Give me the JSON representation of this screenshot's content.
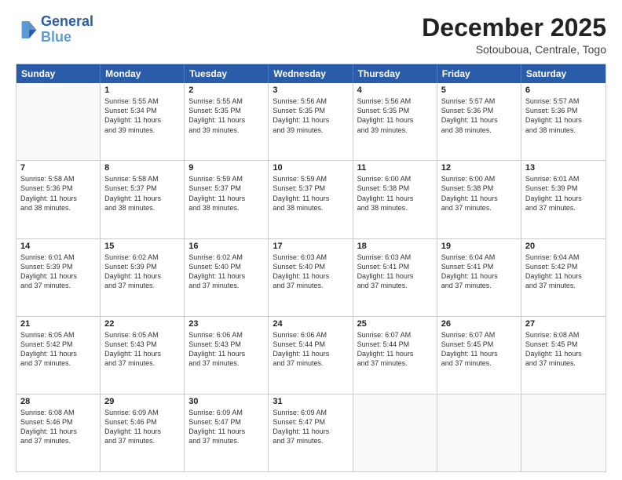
{
  "logo": {
    "line1": "General",
    "line2": "Blue"
  },
  "title": "December 2025",
  "subtitle": "Sotouboua, Centrale, Togo",
  "header_days": [
    "Sunday",
    "Monday",
    "Tuesday",
    "Wednesday",
    "Thursday",
    "Friday",
    "Saturday"
  ],
  "weeks": [
    [
      {
        "day": "",
        "sunrise": "",
        "sunset": "",
        "daylight": ""
      },
      {
        "day": "1",
        "sunrise": "Sunrise: 5:55 AM",
        "sunset": "Sunset: 5:34 PM",
        "daylight": "Daylight: 11 hours and 39 minutes."
      },
      {
        "day": "2",
        "sunrise": "Sunrise: 5:55 AM",
        "sunset": "Sunset: 5:35 PM",
        "daylight": "Daylight: 11 hours and 39 minutes."
      },
      {
        "day": "3",
        "sunrise": "Sunrise: 5:56 AM",
        "sunset": "Sunset: 5:35 PM",
        "daylight": "Daylight: 11 hours and 39 minutes."
      },
      {
        "day": "4",
        "sunrise": "Sunrise: 5:56 AM",
        "sunset": "Sunset: 5:35 PM",
        "daylight": "Daylight: 11 hours and 39 minutes."
      },
      {
        "day": "5",
        "sunrise": "Sunrise: 5:57 AM",
        "sunset": "Sunset: 5:36 PM",
        "daylight": "Daylight: 11 hours and 38 minutes."
      },
      {
        "day": "6",
        "sunrise": "Sunrise: 5:57 AM",
        "sunset": "Sunset: 5:36 PM",
        "daylight": "Daylight: 11 hours and 38 minutes."
      }
    ],
    [
      {
        "day": "7",
        "sunrise": "Sunrise: 5:58 AM",
        "sunset": "Sunset: 5:36 PM",
        "daylight": "Daylight: 11 hours and 38 minutes."
      },
      {
        "day": "8",
        "sunrise": "Sunrise: 5:58 AM",
        "sunset": "Sunset: 5:37 PM",
        "daylight": "Daylight: 11 hours and 38 minutes."
      },
      {
        "day": "9",
        "sunrise": "Sunrise: 5:59 AM",
        "sunset": "Sunset: 5:37 PM",
        "daylight": "Daylight: 11 hours and 38 minutes."
      },
      {
        "day": "10",
        "sunrise": "Sunrise: 5:59 AM",
        "sunset": "Sunset: 5:37 PM",
        "daylight": "Daylight: 11 hours and 38 minutes."
      },
      {
        "day": "11",
        "sunrise": "Sunrise: 6:00 AM",
        "sunset": "Sunset: 5:38 PM",
        "daylight": "Daylight: 11 hours and 38 minutes."
      },
      {
        "day": "12",
        "sunrise": "Sunrise: 6:00 AM",
        "sunset": "Sunset: 5:38 PM",
        "daylight": "Daylight: 11 hours and 37 minutes."
      },
      {
        "day": "13",
        "sunrise": "Sunrise: 6:01 AM",
        "sunset": "Sunset: 5:39 PM",
        "daylight": "Daylight: 11 hours and 37 minutes."
      }
    ],
    [
      {
        "day": "14",
        "sunrise": "Sunrise: 6:01 AM",
        "sunset": "Sunset: 5:39 PM",
        "daylight": "Daylight: 11 hours and 37 minutes."
      },
      {
        "day": "15",
        "sunrise": "Sunrise: 6:02 AM",
        "sunset": "Sunset: 5:39 PM",
        "daylight": "Daylight: 11 hours and 37 minutes."
      },
      {
        "day": "16",
        "sunrise": "Sunrise: 6:02 AM",
        "sunset": "Sunset: 5:40 PM",
        "daylight": "Daylight: 11 hours and 37 minutes."
      },
      {
        "day": "17",
        "sunrise": "Sunrise: 6:03 AM",
        "sunset": "Sunset: 5:40 PM",
        "daylight": "Daylight: 11 hours and 37 minutes."
      },
      {
        "day": "18",
        "sunrise": "Sunrise: 6:03 AM",
        "sunset": "Sunset: 5:41 PM",
        "daylight": "Daylight: 11 hours and 37 minutes."
      },
      {
        "day": "19",
        "sunrise": "Sunrise: 6:04 AM",
        "sunset": "Sunset: 5:41 PM",
        "daylight": "Daylight: 11 hours and 37 minutes."
      },
      {
        "day": "20",
        "sunrise": "Sunrise: 6:04 AM",
        "sunset": "Sunset: 5:42 PM",
        "daylight": "Daylight: 11 hours and 37 minutes."
      }
    ],
    [
      {
        "day": "21",
        "sunrise": "Sunrise: 6:05 AM",
        "sunset": "Sunset: 5:42 PM",
        "daylight": "Daylight: 11 hours and 37 minutes."
      },
      {
        "day": "22",
        "sunrise": "Sunrise: 6:05 AM",
        "sunset": "Sunset: 5:43 PM",
        "daylight": "Daylight: 11 hours and 37 minutes."
      },
      {
        "day": "23",
        "sunrise": "Sunrise: 6:06 AM",
        "sunset": "Sunset: 5:43 PM",
        "daylight": "Daylight: 11 hours and 37 minutes."
      },
      {
        "day": "24",
        "sunrise": "Sunrise: 6:06 AM",
        "sunset": "Sunset: 5:44 PM",
        "daylight": "Daylight: 11 hours and 37 minutes."
      },
      {
        "day": "25",
        "sunrise": "Sunrise: 6:07 AM",
        "sunset": "Sunset: 5:44 PM",
        "daylight": "Daylight: 11 hours and 37 minutes."
      },
      {
        "day": "26",
        "sunrise": "Sunrise: 6:07 AM",
        "sunset": "Sunset: 5:45 PM",
        "daylight": "Daylight: 11 hours and 37 minutes."
      },
      {
        "day": "27",
        "sunrise": "Sunrise: 6:08 AM",
        "sunset": "Sunset: 5:45 PM",
        "daylight": "Daylight: 11 hours and 37 minutes."
      }
    ],
    [
      {
        "day": "28",
        "sunrise": "Sunrise: 6:08 AM",
        "sunset": "Sunset: 5:46 PM",
        "daylight": "Daylight: 11 hours and 37 minutes."
      },
      {
        "day": "29",
        "sunrise": "Sunrise: 6:09 AM",
        "sunset": "Sunset: 5:46 PM",
        "daylight": "Daylight: 11 hours and 37 minutes."
      },
      {
        "day": "30",
        "sunrise": "Sunrise: 6:09 AM",
        "sunset": "Sunset: 5:47 PM",
        "daylight": "Daylight: 11 hours and 37 minutes."
      },
      {
        "day": "31",
        "sunrise": "Sunrise: 6:09 AM",
        "sunset": "Sunset: 5:47 PM",
        "daylight": "Daylight: 11 hours and 37 minutes."
      },
      {
        "day": "",
        "sunrise": "",
        "sunset": "",
        "daylight": ""
      },
      {
        "day": "",
        "sunrise": "",
        "sunset": "",
        "daylight": ""
      },
      {
        "day": "",
        "sunrise": "",
        "sunset": "",
        "daylight": ""
      }
    ]
  ]
}
